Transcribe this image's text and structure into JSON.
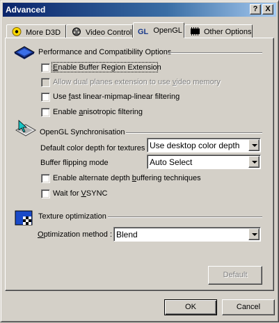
{
  "window": {
    "title": "Advanced",
    "help_label": "?",
    "close_label": "X"
  },
  "tabs": [
    {
      "label": "More D3D",
      "icon": "star-icon",
      "active": false
    },
    {
      "label": "Video Control",
      "icon": "film-reel-icon",
      "active": false
    },
    {
      "label": "OpenGL",
      "icon_text": "GL",
      "icon": "gl-icon",
      "active": true
    },
    {
      "label": "Other Options",
      "icon": "chip-icon",
      "active": false
    }
  ],
  "performance": {
    "title": "Performance and Compatibility Options",
    "options": [
      {
        "label_pre": "",
        "label_u": "E",
        "label_post": "nable Buffer Region Extension",
        "checked": false,
        "enabled": true
      },
      {
        "label_pre": "Allow dual planes extension to use ",
        "label_u": "v",
        "label_post": "ideo memory",
        "checked": false,
        "enabled": false
      },
      {
        "label_pre": "Use ",
        "label_u": "f",
        "label_post": "ast linear-mipmap-linear filtering",
        "checked": false,
        "enabled": true
      },
      {
        "label_pre": "Enable ",
        "label_u": "a",
        "label_post": "nisotropic filtering",
        "checked": false,
        "enabled": true
      }
    ]
  },
  "sync": {
    "title": "OpenGL Synchronisation",
    "color_depth_label": "Default color depth for textures",
    "color_depth_value": "Use desktop color depth",
    "buffer_flip_label": "Buffer flipping mode",
    "buffer_flip_value": "Auto Select",
    "options": [
      {
        "label_pre": "Enable alternate depth ",
        "label_u": "b",
        "label_post": "uffering techniques",
        "checked": false
      },
      {
        "label_pre": "Wait for ",
        "label_u": "V",
        "label_post": "SYNC",
        "checked": false
      }
    ]
  },
  "texture": {
    "title": "Texture optimization",
    "method_label_u": "O",
    "method_label_post": "ptimization method :",
    "method_value": "Blend"
  },
  "buttons": {
    "default_label": "Default",
    "ok_label": "OK",
    "cancel_label": "Cancel"
  },
  "colors": {
    "title_bar_start": "#0a246a",
    "title_bar_end": "#a6caf0",
    "face": "#d4d0c8"
  }
}
